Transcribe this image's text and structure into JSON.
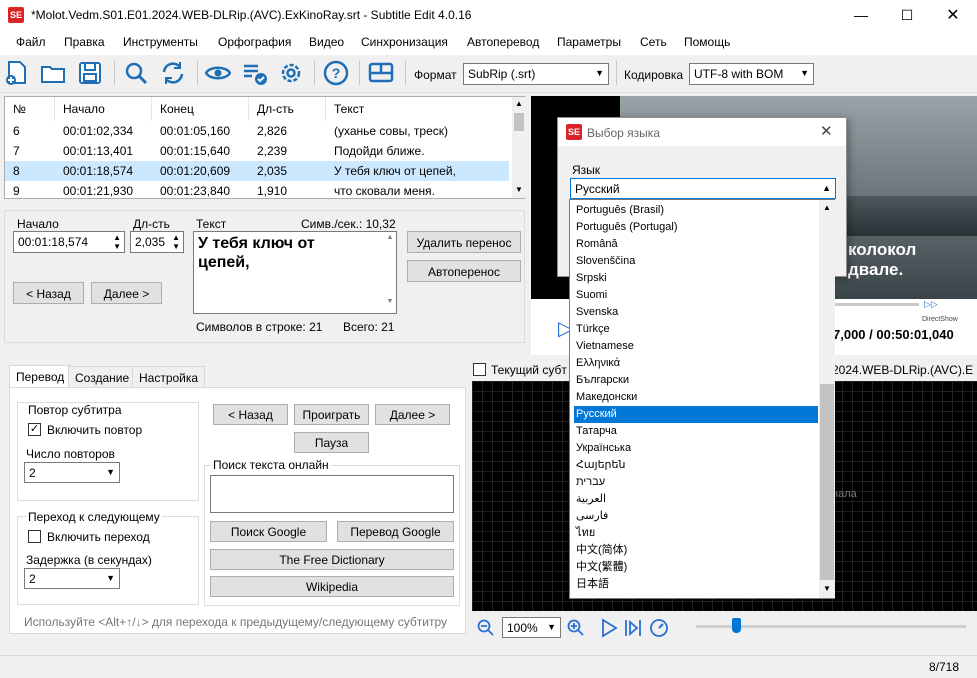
{
  "window": {
    "title": "*Molot.Vedm.S01.E01.2024.WEB-DLRip.(AVC).ExKinoRay.srt - Subtitle Edit 4.0.16",
    "app_icon": "SE"
  },
  "menu": [
    "Файл",
    "Правка",
    "Инструменты",
    "Орфография",
    "Видео",
    "Синхронизация",
    "Автоперевод",
    "Параметры",
    "Сеть",
    "Помощь"
  ],
  "toolbar": {
    "format_label": "Формат",
    "format_value": "SubRip (.srt)",
    "encoding_label": "Кодировка",
    "encoding_value": "UTF-8 with BOM"
  },
  "grid": {
    "headers": [
      "№",
      "Начало",
      "Конец",
      "Дл-сть",
      "Текст"
    ],
    "rows": [
      {
        "n": "6",
        "start": "00:01:02,334",
        "end": "00:01:05,160",
        "dur": "2,826",
        "text": "(уханье совы, треск)"
      },
      {
        "n": "7",
        "start": "00:01:13,401",
        "end": "00:01:15,640",
        "dur": "2,239",
        "text": "Подойди ближе."
      },
      {
        "n": "8",
        "start": "00:01:18,574",
        "end": "00:01:20,609",
        "dur": "2,035",
        "text": "У тебя ключ от цепей,"
      },
      {
        "n": "9",
        "start": "00:01:21,930",
        "end": "00:01:23,840",
        "dur": "1,910",
        "text": "что сковали меня."
      }
    ]
  },
  "edit": {
    "start_label": "Начало",
    "start_value": "00:01:18,574",
    "dur_label": "Дл-сть",
    "dur_value": "2,035",
    "text_label": "Текст",
    "cps_label": "Симв./сек.: 10,32",
    "text_line1": "У тебя ключ от",
    "text_line2": "цепей,",
    "chars_per_line": "Символов в строке: 21",
    "total": "Всего: 21",
    "remove_linebreak": "Удалить перенос",
    "auto_linebreak": "Автоперенос",
    "prev": "< Назад",
    "next": "Далее >"
  },
  "tabs": [
    "Перевод",
    "Создание",
    "Настройка"
  ],
  "translate_tab": {
    "repeat_group": "Повтор субтитра",
    "enable_repeat": "Включить повтор",
    "repeat_count_label": "Число повторов",
    "repeat_count": "2",
    "next_group": "Переход к следующему",
    "enable_next": "Включить переход",
    "delay_label": "Задержка (в секундах)",
    "delay_value": "2",
    "back": "< Назад",
    "play": "Проиграть",
    "next": "Далее >",
    "pause": "Пауза",
    "search_group": "Поиск текста онлайн",
    "google_search": "Поиск Google",
    "google_translate": "Перевод Google",
    "free_dictionary": "The Free Dictionary",
    "wikipedia": "Wikipedia",
    "hint": "Используйте <Alt+↑/↓> для перехода к предыдущему/следующему субтитру"
  },
  "video": {
    "subtitle_line1": "колокол",
    "subtitle_line2": "двале.",
    "directshow": "DirectShow",
    "time": "7,000 / 00:50:01,040",
    "current_sub_label": "Текущий субт",
    "file_fragment": "2024.WEB-DLRip.(AVC).E",
    "wave_hint": "нала",
    "zoom": "100%"
  },
  "dialog": {
    "title": "Выбор языка",
    "lang_label": "Язык",
    "selected": "Русский",
    "options": [
      "Português (Brasil)",
      "Português (Portugal)",
      "Română",
      "Slovenščina",
      "Srpski",
      "Suomi",
      "Svenska",
      "Türkçe",
      "Vietnamese",
      "Ελληνικά",
      "Български",
      "Македонски",
      "Русский",
      "Татарча",
      "Українська",
      "Հայերեն",
      "עברית",
      "العربية",
      "فارسی",
      "ไทย",
      "中文(简体)",
      "中文(繁體)",
      "日本語"
    ]
  },
  "status": {
    "position": "8/718"
  }
}
